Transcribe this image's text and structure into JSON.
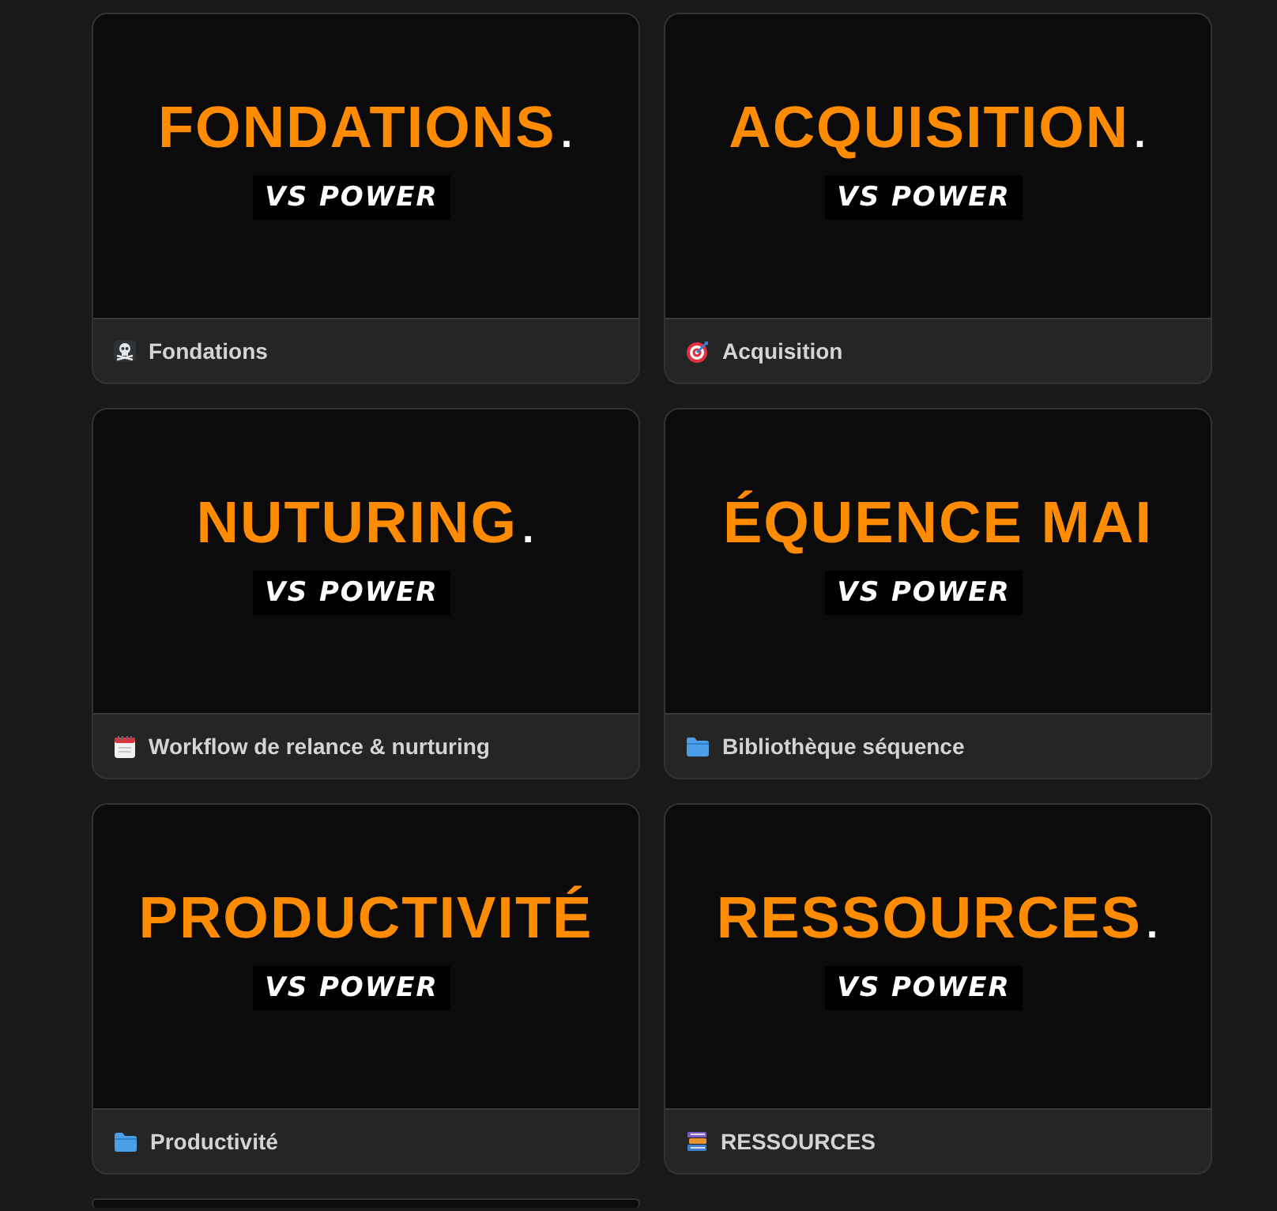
{
  "cards": [
    {
      "cover_title": "FONDATIONS",
      "cover_mark": ".",
      "cover_tagline": "VS POWER",
      "kind": "skull",
      "name": "Fondations"
    },
    {
      "cover_title": "ACQUISITION",
      "cover_mark": ".",
      "cover_tagline": "VS POWER",
      "kind": "target",
      "name": "Acquisition"
    },
    {
      "cover_title": "NUTURING",
      "cover_mark": ".",
      "cover_tagline": "VS POWER",
      "kind": "notepad",
      "name": "Workflow de relance & nurturing"
    },
    {
      "cover_title": "ÉQUENCE MAI",
      "cover_tagline": "VS POWER",
      "kind": "folder",
      "name": "Bibliothèque séquence"
    },
    {
      "cover_title": "PRODUCTIVITÉ",
      "cover_tagline": "VS POWER",
      "kind": "folder",
      "name": "Productivité"
    },
    {
      "cover_title": "RESSOURCES",
      "cover_mark": ".",
      "cover_tagline": "VS POWER",
      "kind": "books",
      "name": "RESSOURCES"
    }
  ]
}
